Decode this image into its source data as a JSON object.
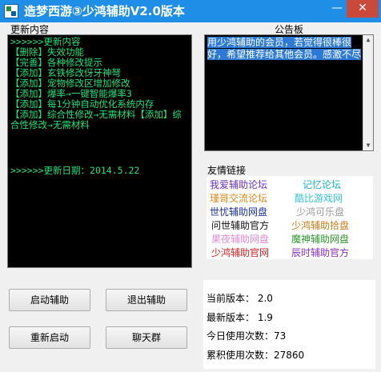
{
  "window": {
    "title": "造梦西游③少鸿辅助V2.0版本",
    "min_glyph": "—",
    "close_glyph": "✕",
    "titlebar_color": "#1e8ee6"
  },
  "sections": {
    "update_label": "更新内容",
    "notice_label": "公告板",
    "links_label": "友情链接"
  },
  "update_log": {
    "lines": [
      ">>>>>>更新内容",
      "【删除】失效功能",
      "【完善】各种修改提示",
      "【添加】玄铁修改伢牙神弩",
      "【添加】宠物修改区增加修改",
      "【添加】爆率→一键智能爆率3",
      "【添加】每1分钟自动优化系统内存",
      "【添加】综合性修改→无需材料【添加】综合性修改→无需材料"
    ],
    "date_line": ">>>>>>更新日期：2014.5.22",
    "text_color": "#24e07a"
  },
  "notice": {
    "selected_text": "用少鸿辅助的会员，若觉得很棒很好，希望推荐给其他会员。感激不尽"
  },
  "links": [
    {
      "label": "我爱辅助论坛",
      "color": "#6a2fc7"
    },
    {
      "label": "记忆论坛",
      "color": "#1ab0c9"
    },
    {
      "label": "瑾哥交流论坛",
      "color": "#e08a1a"
    },
    {
      "label": "酷比游戏网",
      "color": "#35c4d6"
    },
    {
      "label": "世忧辅助网盘",
      "color": "#1a2fa5"
    },
    {
      "label": "少鸿可乐盘",
      "color": "#9a9a9a"
    },
    {
      "label": "问世辅助官方",
      "color": "#111111"
    },
    {
      "label": "少鸿辅助拾盘",
      "color": "#c77a1a"
    },
    {
      "label": "果夜辅助网盘",
      "color": "#e08ad6"
    },
    {
      "label": "魔神辅助网盘",
      "color": "#2b9a2b"
    },
    {
      "label": "少鸿辅助官网",
      "color": "#d42020"
    },
    {
      "label": "辰时辅助官方",
      "color": "#8a2fc7"
    }
  ],
  "buttons": {
    "start": "启动辅助",
    "exit": "退出辅助",
    "restart": "重新启动",
    "chat": "聊天群"
  },
  "stats": {
    "current_version": "当前版本： 2.0",
    "latest_version": "最新版本： 1.9",
    "today_uses": "今日使用次数：73",
    "total_uses": "累积使用次数：27860"
  }
}
